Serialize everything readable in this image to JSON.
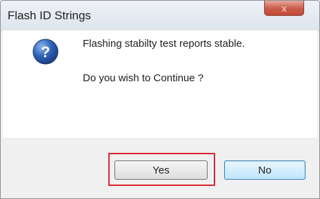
{
  "dialog": {
    "title": "Flash ID Strings",
    "close_label": "x",
    "icon": "question-icon",
    "message_line1": "Flashing stabilty test reports stable.",
    "message_line2": "Do you wish to Continue ?",
    "buttons": {
      "yes_label": "Yes",
      "no_label": "No"
    }
  },
  "colors": {
    "highlight": "#d9232d",
    "icon": "#2a5db0"
  }
}
